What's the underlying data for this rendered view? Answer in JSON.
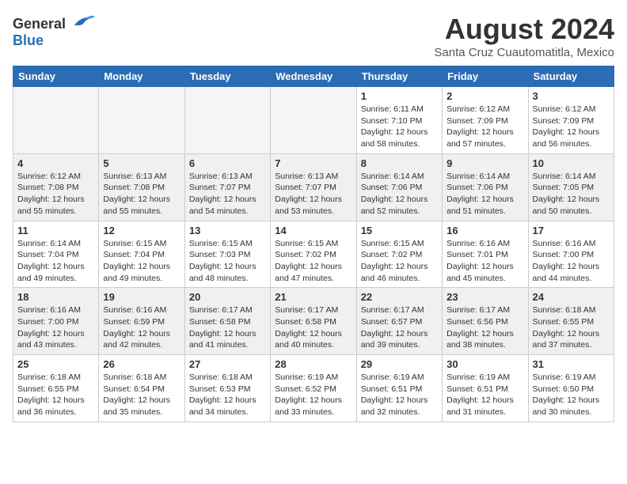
{
  "header": {
    "logo_general": "General",
    "logo_blue": "Blue",
    "month_title": "August 2024",
    "location": "Santa Cruz Cuautomatitla, Mexico"
  },
  "weekdays": [
    "Sunday",
    "Monday",
    "Tuesday",
    "Wednesday",
    "Thursday",
    "Friday",
    "Saturday"
  ],
  "weeks": [
    [
      {
        "day": "",
        "sunrise": "",
        "sunset": "",
        "daylight": "",
        "empty": true
      },
      {
        "day": "",
        "sunrise": "",
        "sunset": "",
        "daylight": "",
        "empty": true
      },
      {
        "day": "",
        "sunrise": "",
        "sunset": "",
        "daylight": "",
        "empty": true
      },
      {
        "day": "",
        "sunrise": "",
        "sunset": "",
        "daylight": "",
        "empty": true
      },
      {
        "day": "1",
        "sunrise": "Sunrise: 6:11 AM",
        "sunset": "Sunset: 7:10 PM",
        "daylight": "Daylight: 12 hours and 58 minutes.",
        "empty": false
      },
      {
        "day": "2",
        "sunrise": "Sunrise: 6:12 AM",
        "sunset": "Sunset: 7:09 PM",
        "daylight": "Daylight: 12 hours and 57 minutes.",
        "empty": false
      },
      {
        "day": "3",
        "sunrise": "Sunrise: 6:12 AM",
        "sunset": "Sunset: 7:09 PM",
        "daylight": "Daylight: 12 hours and 56 minutes.",
        "empty": false
      }
    ],
    [
      {
        "day": "4",
        "sunrise": "Sunrise: 6:12 AM",
        "sunset": "Sunset: 7:08 PM",
        "daylight": "Daylight: 12 hours and 55 minutes.",
        "empty": false
      },
      {
        "day": "5",
        "sunrise": "Sunrise: 6:13 AM",
        "sunset": "Sunset: 7:08 PM",
        "daylight": "Daylight: 12 hours and 55 minutes.",
        "empty": false
      },
      {
        "day": "6",
        "sunrise": "Sunrise: 6:13 AM",
        "sunset": "Sunset: 7:07 PM",
        "daylight": "Daylight: 12 hours and 54 minutes.",
        "empty": false
      },
      {
        "day": "7",
        "sunrise": "Sunrise: 6:13 AM",
        "sunset": "Sunset: 7:07 PM",
        "daylight": "Daylight: 12 hours and 53 minutes.",
        "empty": false
      },
      {
        "day": "8",
        "sunrise": "Sunrise: 6:14 AM",
        "sunset": "Sunset: 7:06 PM",
        "daylight": "Daylight: 12 hours and 52 minutes.",
        "empty": false
      },
      {
        "day": "9",
        "sunrise": "Sunrise: 6:14 AM",
        "sunset": "Sunset: 7:06 PM",
        "daylight": "Daylight: 12 hours and 51 minutes.",
        "empty": false
      },
      {
        "day": "10",
        "sunrise": "Sunrise: 6:14 AM",
        "sunset": "Sunset: 7:05 PM",
        "daylight": "Daylight: 12 hours and 50 minutes.",
        "empty": false
      }
    ],
    [
      {
        "day": "11",
        "sunrise": "Sunrise: 6:14 AM",
        "sunset": "Sunset: 7:04 PM",
        "daylight": "Daylight: 12 hours and 49 minutes.",
        "empty": false
      },
      {
        "day": "12",
        "sunrise": "Sunrise: 6:15 AM",
        "sunset": "Sunset: 7:04 PM",
        "daylight": "Daylight: 12 hours and 49 minutes.",
        "empty": false
      },
      {
        "day": "13",
        "sunrise": "Sunrise: 6:15 AM",
        "sunset": "Sunset: 7:03 PM",
        "daylight": "Daylight: 12 hours and 48 minutes.",
        "empty": false
      },
      {
        "day": "14",
        "sunrise": "Sunrise: 6:15 AM",
        "sunset": "Sunset: 7:02 PM",
        "daylight": "Daylight: 12 hours and 47 minutes.",
        "empty": false
      },
      {
        "day": "15",
        "sunrise": "Sunrise: 6:15 AM",
        "sunset": "Sunset: 7:02 PM",
        "daylight": "Daylight: 12 hours and 46 minutes.",
        "empty": false
      },
      {
        "day": "16",
        "sunrise": "Sunrise: 6:16 AM",
        "sunset": "Sunset: 7:01 PM",
        "daylight": "Daylight: 12 hours and 45 minutes.",
        "empty": false
      },
      {
        "day": "17",
        "sunrise": "Sunrise: 6:16 AM",
        "sunset": "Sunset: 7:00 PM",
        "daylight": "Daylight: 12 hours and 44 minutes.",
        "empty": false
      }
    ],
    [
      {
        "day": "18",
        "sunrise": "Sunrise: 6:16 AM",
        "sunset": "Sunset: 7:00 PM",
        "daylight": "Daylight: 12 hours and 43 minutes.",
        "empty": false
      },
      {
        "day": "19",
        "sunrise": "Sunrise: 6:16 AM",
        "sunset": "Sunset: 6:59 PM",
        "daylight": "Daylight: 12 hours and 42 minutes.",
        "empty": false
      },
      {
        "day": "20",
        "sunrise": "Sunrise: 6:17 AM",
        "sunset": "Sunset: 6:58 PM",
        "daylight": "Daylight: 12 hours and 41 minutes.",
        "empty": false
      },
      {
        "day": "21",
        "sunrise": "Sunrise: 6:17 AM",
        "sunset": "Sunset: 6:58 PM",
        "daylight": "Daylight: 12 hours and 40 minutes.",
        "empty": false
      },
      {
        "day": "22",
        "sunrise": "Sunrise: 6:17 AM",
        "sunset": "Sunset: 6:57 PM",
        "daylight": "Daylight: 12 hours and 39 minutes.",
        "empty": false
      },
      {
        "day": "23",
        "sunrise": "Sunrise: 6:17 AM",
        "sunset": "Sunset: 6:56 PM",
        "daylight": "Daylight: 12 hours and 38 minutes.",
        "empty": false
      },
      {
        "day": "24",
        "sunrise": "Sunrise: 6:18 AM",
        "sunset": "Sunset: 6:55 PM",
        "daylight": "Daylight: 12 hours and 37 minutes.",
        "empty": false
      }
    ],
    [
      {
        "day": "25",
        "sunrise": "Sunrise: 6:18 AM",
        "sunset": "Sunset: 6:55 PM",
        "daylight": "Daylight: 12 hours and 36 minutes.",
        "empty": false
      },
      {
        "day": "26",
        "sunrise": "Sunrise: 6:18 AM",
        "sunset": "Sunset: 6:54 PM",
        "daylight": "Daylight: 12 hours and 35 minutes.",
        "empty": false
      },
      {
        "day": "27",
        "sunrise": "Sunrise: 6:18 AM",
        "sunset": "Sunset: 6:53 PM",
        "daylight": "Daylight: 12 hours and 34 minutes.",
        "empty": false
      },
      {
        "day": "28",
        "sunrise": "Sunrise: 6:19 AM",
        "sunset": "Sunset: 6:52 PM",
        "daylight": "Daylight: 12 hours and 33 minutes.",
        "empty": false
      },
      {
        "day": "29",
        "sunrise": "Sunrise: 6:19 AM",
        "sunset": "Sunset: 6:51 PM",
        "daylight": "Daylight: 12 hours and 32 minutes.",
        "empty": false
      },
      {
        "day": "30",
        "sunrise": "Sunrise: 6:19 AM",
        "sunset": "Sunset: 6:51 PM",
        "daylight": "Daylight: 12 hours and 31 minutes.",
        "empty": false
      },
      {
        "day": "31",
        "sunrise": "Sunrise: 6:19 AM",
        "sunset": "Sunset: 6:50 PM",
        "daylight": "Daylight: 12 hours and 30 minutes.",
        "empty": false
      }
    ]
  ]
}
